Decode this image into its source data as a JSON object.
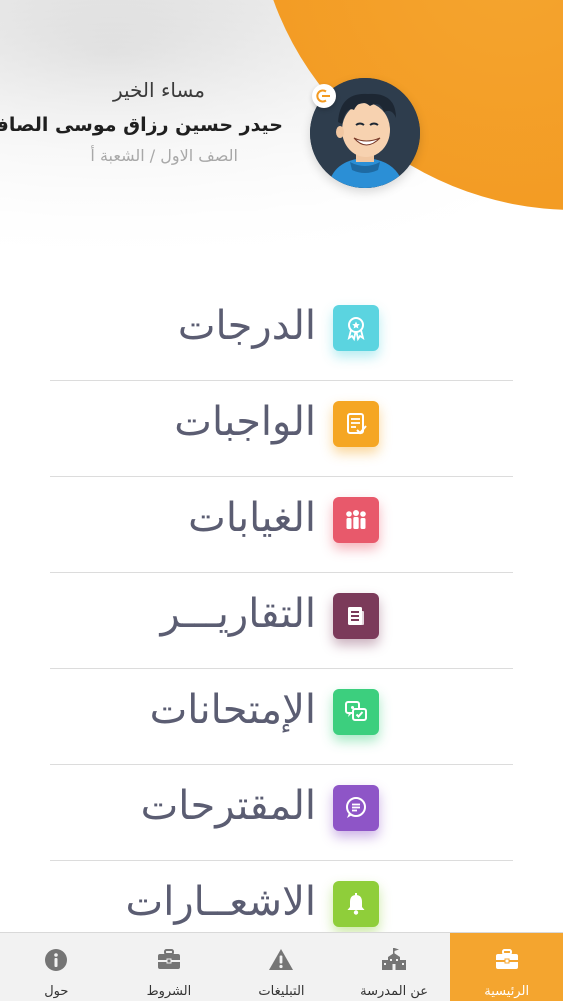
{
  "header": {
    "greeting": "مساء الخير",
    "student_name": "حيدر حسين رزاق موسى الصافى",
    "class_name": "الصف الاول / الشعبة أ",
    "avatar_icon": "student-avatar",
    "logout_icon": "logout-icon"
  },
  "menu": {
    "items": [
      {
        "label": "الدرجات",
        "icon": "award-icon",
        "color": "#5bd4e0"
      },
      {
        "label": "الواجبات",
        "icon": "homework-icon",
        "color": "#f5a623"
      },
      {
        "label": "الغيابات",
        "icon": "people-icon",
        "color": "#e8596b"
      },
      {
        "label": "التقاريـــر",
        "icon": "report-icon",
        "color": "#7b3a5a"
      },
      {
        "label": "الإمتحانات",
        "icon": "exam-icon",
        "color": "#3ccf7e"
      },
      {
        "label": "المقترحات",
        "icon": "chat-icon",
        "color": "#8e55c7"
      },
      {
        "label": "الاشعــارات",
        "icon": "bell-icon",
        "color": "#8fce3a"
      }
    ]
  },
  "tabbar": {
    "tabs": [
      {
        "label": "حول",
        "icon": "info-icon"
      },
      {
        "label": "الشروط",
        "icon": "briefcase-icon"
      },
      {
        "label": "التبليغات",
        "icon": "warning-icon"
      },
      {
        "label": "عن المدرسة",
        "icon": "school-icon"
      },
      {
        "label": "الرئيسية",
        "icon": "home-briefcase-icon",
        "active": true
      }
    ],
    "accent": "#f4a52f"
  }
}
